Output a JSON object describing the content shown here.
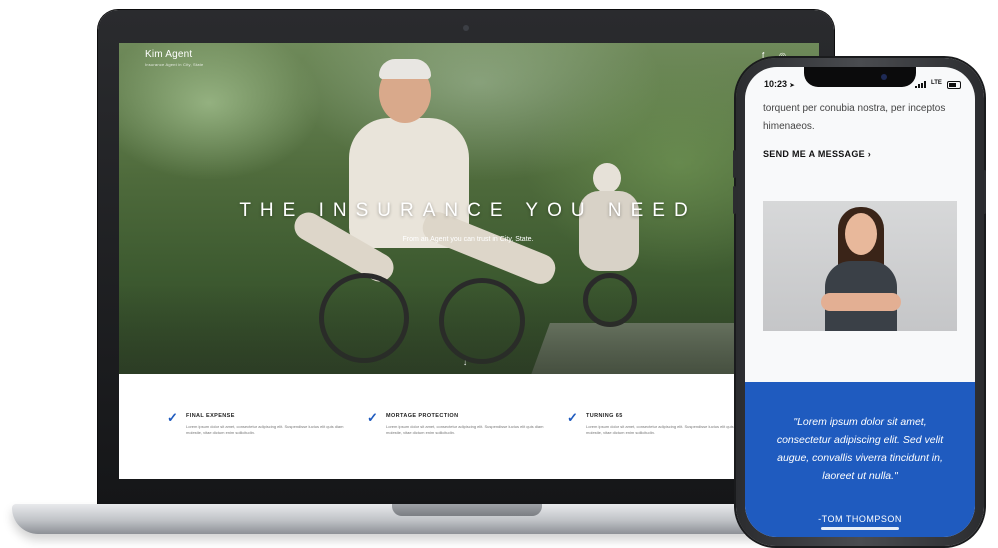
{
  "laptop": {
    "brand": {
      "name": "Kim Agent",
      "tagline": "Insurance Agent in City, State"
    },
    "social_icons": [
      "facebook-icon",
      "instagram-icon"
    ],
    "hero": {
      "title": "THE INSURANCE YOU NEED",
      "subtitle": "From an Agent you can trust in City, State.",
      "scroll_icon": "arrow-down-icon"
    },
    "features": [
      {
        "title": "FINAL EXPENSE",
        "desc": "Lorem ipsum dolor sit amet, consectetur adipiscing elit. Suspendisse luctus elit quis diam molestie, vitae dictum enim sollicitudin."
      },
      {
        "title": "MORTAGE PROTECTION",
        "desc": "Lorem ipsum dolor sit amet, consectetur adipiscing elit. Suspendisse luctus elit quis diam molestie, vitae dictum enim sollicitudin."
      },
      {
        "title": "TURNING 65",
        "desc": "Lorem ipsum dolor sit amet, consectetur adipiscing elit. Suspendisse luctus elit quis diam molestie, vitae dictum enim sollicitudin."
      }
    ],
    "check_glyph": "✓"
  },
  "phone": {
    "status": {
      "time": "10:23",
      "location_glyph": "➤",
      "network": "LTE"
    },
    "body_text": "torquent per conubia nostra, per inceptos himenaeos.",
    "cta": "SEND ME A MESSAGE ›",
    "testimonial": {
      "quote": "\"Lorem ipsum dolor sit amet, consectetur adipiscing elit. Sed velit augue, convallis viverra tincidunt in, laoreet ut nulla.\"",
      "author": "-TOM THOMPSON"
    }
  },
  "colors": {
    "accent_blue": "#1f5bbf",
    "device_dark": "#1a1b1d",
    "laptop_silver": "#bfc2c6"
  }
}
